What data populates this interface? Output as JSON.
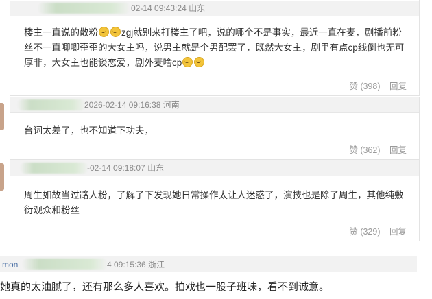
{
  "comments": [
    {
      "meta": "02-14 09:43:24 山东",
      "text_a": "楼主一直说的散粉",
      "text_b": "zgj就别来打楼主了吧，说的哪个不是事实，最近一直在麦，剧播前粉丝不一直唧唧歪歪的大女主吗，说男主就是个男配罢了，既然大女主，剧里有点cp线倒也无可厚非，大女主也能谈恋爱，剧外麦啥cp",
      "like": "赞 (398)",
      "reply": "回复"
    },
    {
      "meta": "2026-02-14 09:16:38 河南",
      "text": "台词太差了，也不知道下功夫，",
      "like": "赞 (362)",
      "reply": "回复"
    },
    {
      "meta": "-02-14 09:18:07 山东",
      "text": "周生如故当过路人粉，了解了下发现她日常操作太让人迷惑了，演技也是除了周生，其他纯敷衍观众和粉丝",
      "like": "赞 (329)",
      "reply": "回复"
    }
  ],
  "bottom_comment": {
    "meta_prefix": "mon",
    "meta": "4 09:15:36 浙江",
    "text": "她真的太油腻了，还有那么多人喜欢。拍戏也一股子班味，看不到诚意。"
  },
  "icons": [
    "grin-emoji-icon"
  ]
}
